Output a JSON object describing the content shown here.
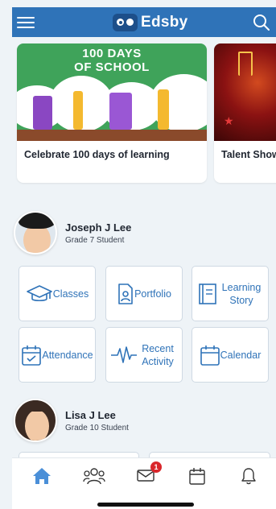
{
  "header": {
    "app_name": "Edsby"
  },
  "carousel": {
    "cards": [
      {
        "art_text": "100 DAYS\nOF SCHOOL",
        "caption": "Celebrate 100 days of learning"
      },
      {
        "caption": "Talent Show"
      }
    ]
  },
  "profiles": [
    {
      "name": "Joseph J Lee",
      "subtitle": "Grade 7 Student",
      "tiles": [
        {
          "label": "Classes",
          "icon": "graduation-cap-icon"
        },
        {
          "label": "Portfolio",
          "icon": "portfolio-icon"
        },
        {
          "label": "Learning Story",
          "icon": "book-icon"
        },
        {
          "label": "Attendance",
          "icon": "calendar-check-icon"
        },
        {
          "label": "Recent Activity",
          "icon": "activity-pulse-icon"
        },
        {
          "label": "Calendar",
          "icon": "calendar-icon"
        }
      ]
    },
    {
      "name": "Lisa J Lee",
      "subtitle": "Grade 10 Student"
    }
  ],
  "bottom_nav": {
    "items": [
      "home-icon",
      "people-icon",
      "mail-icon",
      "calendar-icon",
      "bell-icon"
    ],
    "mail_badge": "1",
    "active": "home"
  },
  "colors": {
    "brand": "#2f73b8",
    "badge": "#d9262b",
    "background": "#eef3f7"
  }
}
